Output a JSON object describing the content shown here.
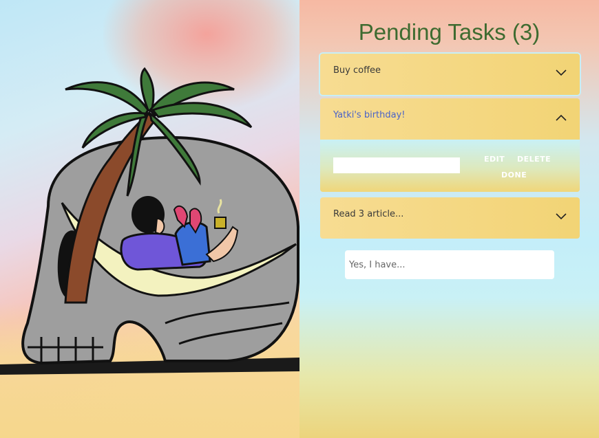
{
  "header": {
    "title": "Pending Tasks (3)"
  },
  "tasks": [
    {
      "label": "Buy coffee",
      "expanded": false,
      "chevron_icon": "chevron-down-icon"
    },
    {
      "label": "Yatki's birthday!",
      "expanded": true,
      "chevron_icon": "chevron-up-icon",
      "edit_value": "",
      "actions": {
        "edit": "EDIT",
        "delete": "DELETE",
        "done": "DONE"
      }
    },
    {
      "label": "Read 3 article...",
      "expanded": false,
      "chevron_icon": "chevron-down-icon"
    }
  ],
  "new_task": {
    "placeholder": "Yes, I have..."
  },
  "colors": {
    "title": "#3e6b30",
    "task_bg": "#f2d475",
    "active_label": "#4a63c8",
    "action_text": "#ffffff"
  },
  "illustration": {
    "subject": "skull-island-hammock-illustration"
  }
}
